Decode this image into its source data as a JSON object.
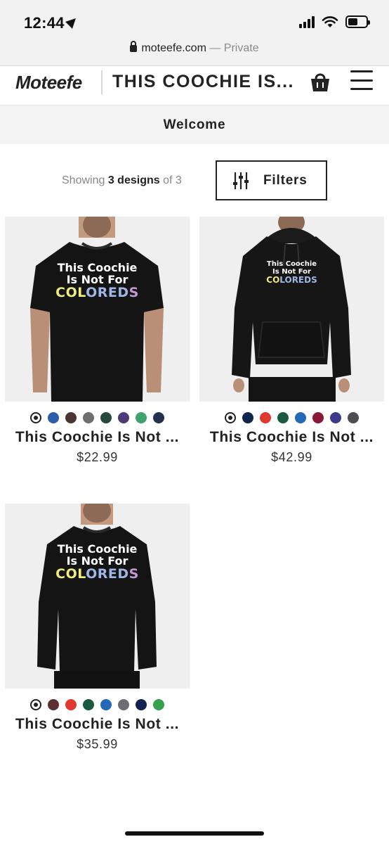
{
  "status_bar": {
    "time": "12:44"
  },
  "browser": {
    "domain": "moteefe.com",
    "private_label": "— Private"
  },
  "header": {
    "logo": "Moteefe",
    "title": "THIS COOCHIE IS..."
  },
  "welcome": "Welcome",
  "toolbar": {
    "showing_prefix": "Showing",
    "showing_count": "3 designs",
    "showing_suffix": "of 3",
    "filters_label": "Filters"
  },
  "products": [
    {
      "title": "This Coochie Is Not ...",
      "price": "$22.99",
      "print_lines": [
        "This Coochie",
        "Is Not For",
        "COLOREDS"
      ],
      "swatches": [
        "#2a5ea8",
        "#4a3434",
        "#6e6e70",
        "#24483a",
        "#4d3a78",
        "#3fa36c",
        "#25324f"
      ]
    },
    {
      "title": "This Coochie Is Not ...",
      "price": "$42.99",
      "print_lines": [
        "This Coochie",
        "Is Not For",
        "COLOREDS"
      ],
      "swatches": [
        "#12234f",
        "#e0392f",
        "#1b5a40",
        "#2469b8",
        "#8a1638",
        "#3d3a8c",
        "#4e4e52"
      ]
    },
    {
      "title": "This Coochie Is Not ...",
      "price": "$35.99",
      "print_lines": [
        "This Coochie",
        "Is Not For",
        "COLOREDS"
      ],
      "swatches": [
        "#5a3030",
        "#e0392f",
        "#1b5a40",
        "#2469b8",
        "#6e6e72",
        "#12234f",
        "#36a04c"
      ]
    }
  ]
}
